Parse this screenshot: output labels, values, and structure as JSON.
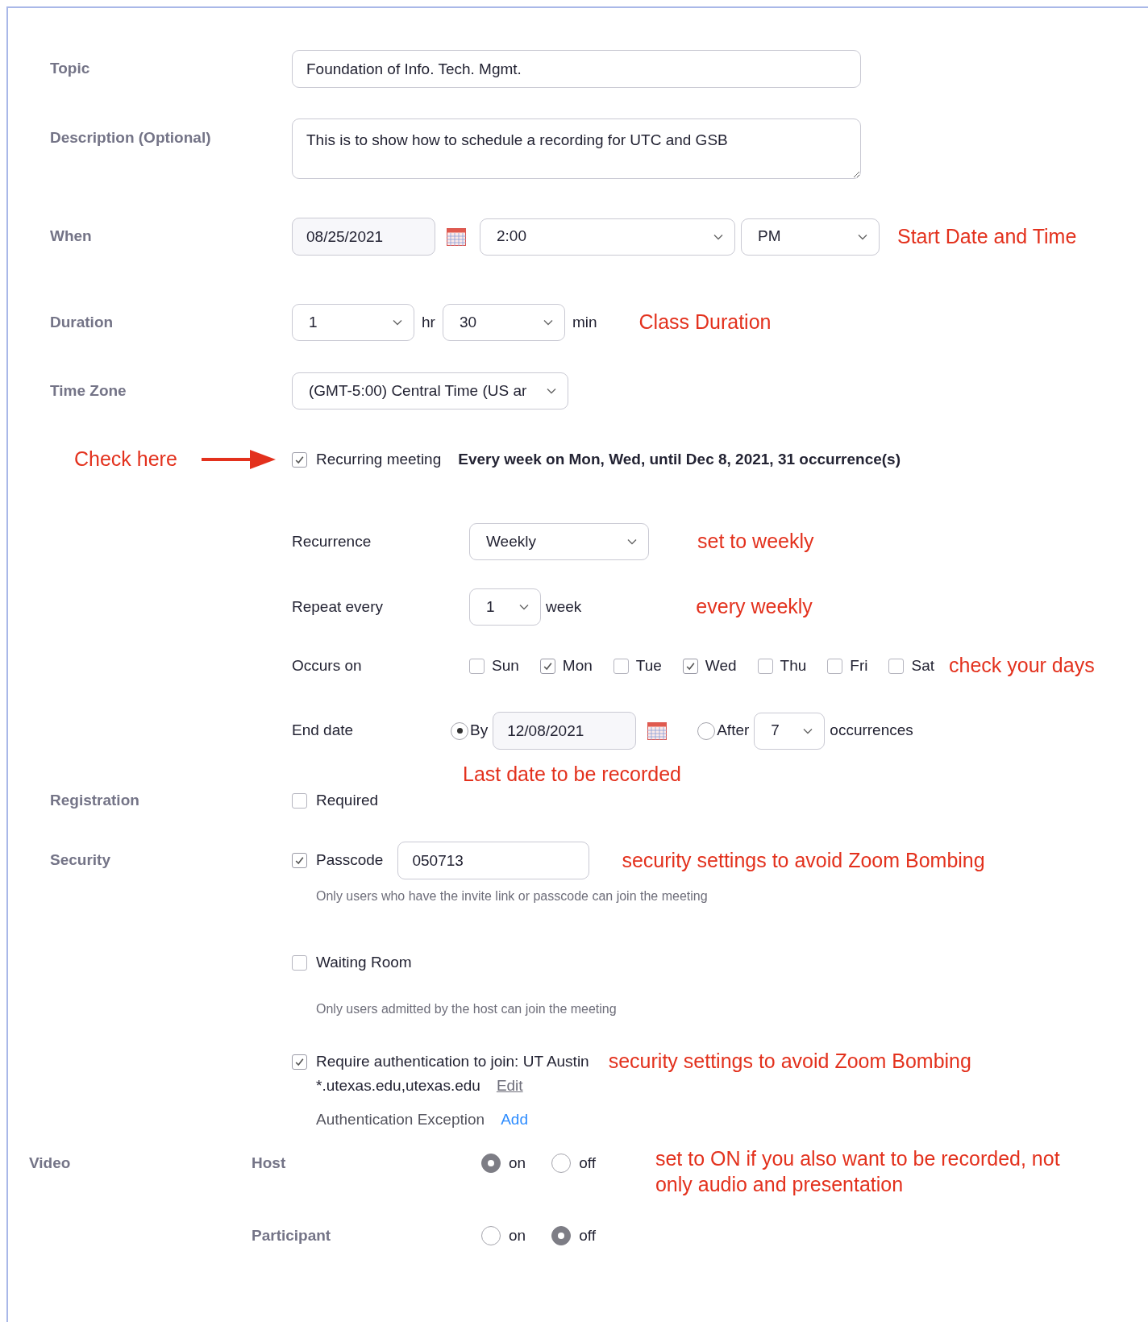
{
  "form": {
    "topic": {
      "label": "Topic",
      "value": "Foundation of Info. Tech. Mgmt."
    },
    "description": {
      "label": "Description (Optional)",
      "value": "This is to show how to schedule a recording for UTC and GSB"
    },
    "when": {
      "label": "When",
      "date": "08/25/2021",
      "time": "2:00",
      "ampm": "PM",
      "annotation": "Start Date and Time"
    },
    "duration": {
      "label": "Duration",
      "hours": "1",
      "hours_unit": "hr",
      "minutes": "30",
      "minutes_unit": "min",
      "annotation": "Class Duration"
    },
    "time_zone": {
      "label": "Time Zone",
      "value": "(GMT-5:00) Central Time (US ar"
    },
    "recurring": {
      "callout": "Check here",
      "label": "Recurring meeting",
      "checked": true,
      "summary": "Every week on Mon, Wed, until Dec 8, 2021, 31 occurrence(s)"
    },
    "recurrence": {
      "label": "Recurrence",
      "value": "Weekly",
      "annotation": "set to weekly"
    },
    "repeat_every": {
      "label": "Repeat every",
      "value": "1",
      "unit": "week",
      "annotation": "every weekly"
    },
    "occurs_on": {
      "label": "Occurs on",
      "annotation": "check your days",
      "days": [
        {
          "label": "Sun",
          "checked": false
        },
        {
          "label": "Mon",
          "checked": true
        },
        {
          "label": "Tue",
          "checked": false
        },
        {
          "label": "Wed",
          "checked": true
        },
        {
          "label": "Thu",
          "checked": false
        },
        {
          "label": "Fri",
          "checked": false
        },
        {
          "label": "Sat",
          "checked": false
        }
      ]
    },
    "end_date": {
      "label": "End date",
      "by": {
        "label": "By",
        "selected": true,
        "date": "12/08/2021"
      },
      "after": {
        "label": "After",
        "selected": false,
        "count": "7",
        "unit": "occurrences"
      },
      "annotation": "Last date to be recorded"
    },
    "registration": {
      "label": "Registration",
      "option": {
        "label": "Required",
        "checked": false
      }
    },
    "security": {
      "label": "Security",
      "passcode": {
        "label": "Passcode",
        "checked": true,
        "value": "050713",
        "hint": "Only users who have the invite link or passcode can join the meeting",
        "annotation": "security settings to avoid Zoom Bombing"
      },
      "waiting_room": {
        "label": "Waiting Room",
        "checked": false,
        "hint": "Only users admitted by the host can join the meeting"
      },
      "authentication": {
        "label": "Require authentication to join: UT Austin",
        "checked": true,
        "domains": "*.utexas.edu,utexas.edu",
        "edit_link": "Edit",
        "exception_label": "Authentication Exception",
        "exception_link": "Add",
        "annotation": "security settings to avoid Zoom Bombing"
      }
    },
    "video": {
      "label": "Video",
      "annotation": "set to ON if you also want to be recorded, not only audio and presentation",
      "rows": [
        {
          "label": "Host",
          "options": [
            {
              "label": "on",
              "selected": true
            },
            {
              "label": "off",
              "selected": false
            }
          ]
        },
        {
          "label": "Participant",
          "options": [
            {
              "label": "on",
              "selected": false
            },
            {
              "label": "off",
              "selected": true
            }
          ]
        }
      ]
    }
  }
}
